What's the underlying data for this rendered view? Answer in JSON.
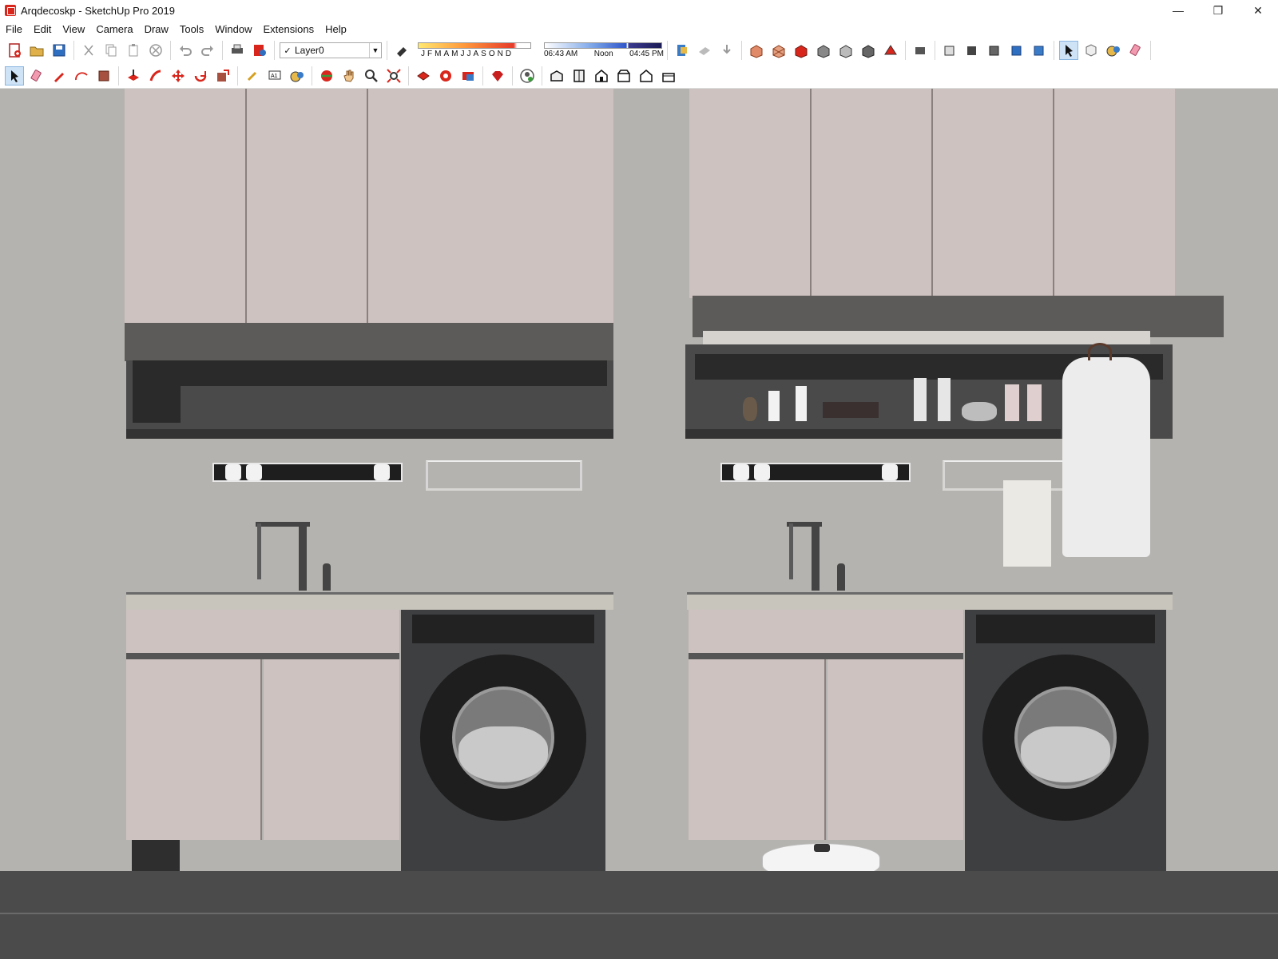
{
  "window": {
    "title": "Arqdecoskp - SketchUp Pro 2019",
    "controls": {
      "minimize": "—",
      "maximize": "❐",
      "close": "✕"
    }
  },
  "menu": [
    "File",
    "Edit",
    "View",
    "Camera",
    "Draw",
    "Tools",
    "Window",
    "Extensions",
    "Help"
  ],
  "layer": {
    "check": "✓",
    "name": "Layer0",
    "arrow": "▼"
  },
  "shadow": {
    "months": [
      "J",
      "F",
      "M",
      "A",
      "M",
      "J",
      "J",
      "A",
      "S",
      "O",
      "N",
      "D"
    ],
    "time_start": "06:43 AM",
    "time_noon": "Noon",
    "time_end": "04:45 PM"
  },
  "colors": {
    "background": "#b5b3af",
    "cabinet": "#cdc2bf",
    "dark": "#5c5b5a",
    "washer": "#3e3f41",
    "selection": "#cfe3f7"
  }
}
